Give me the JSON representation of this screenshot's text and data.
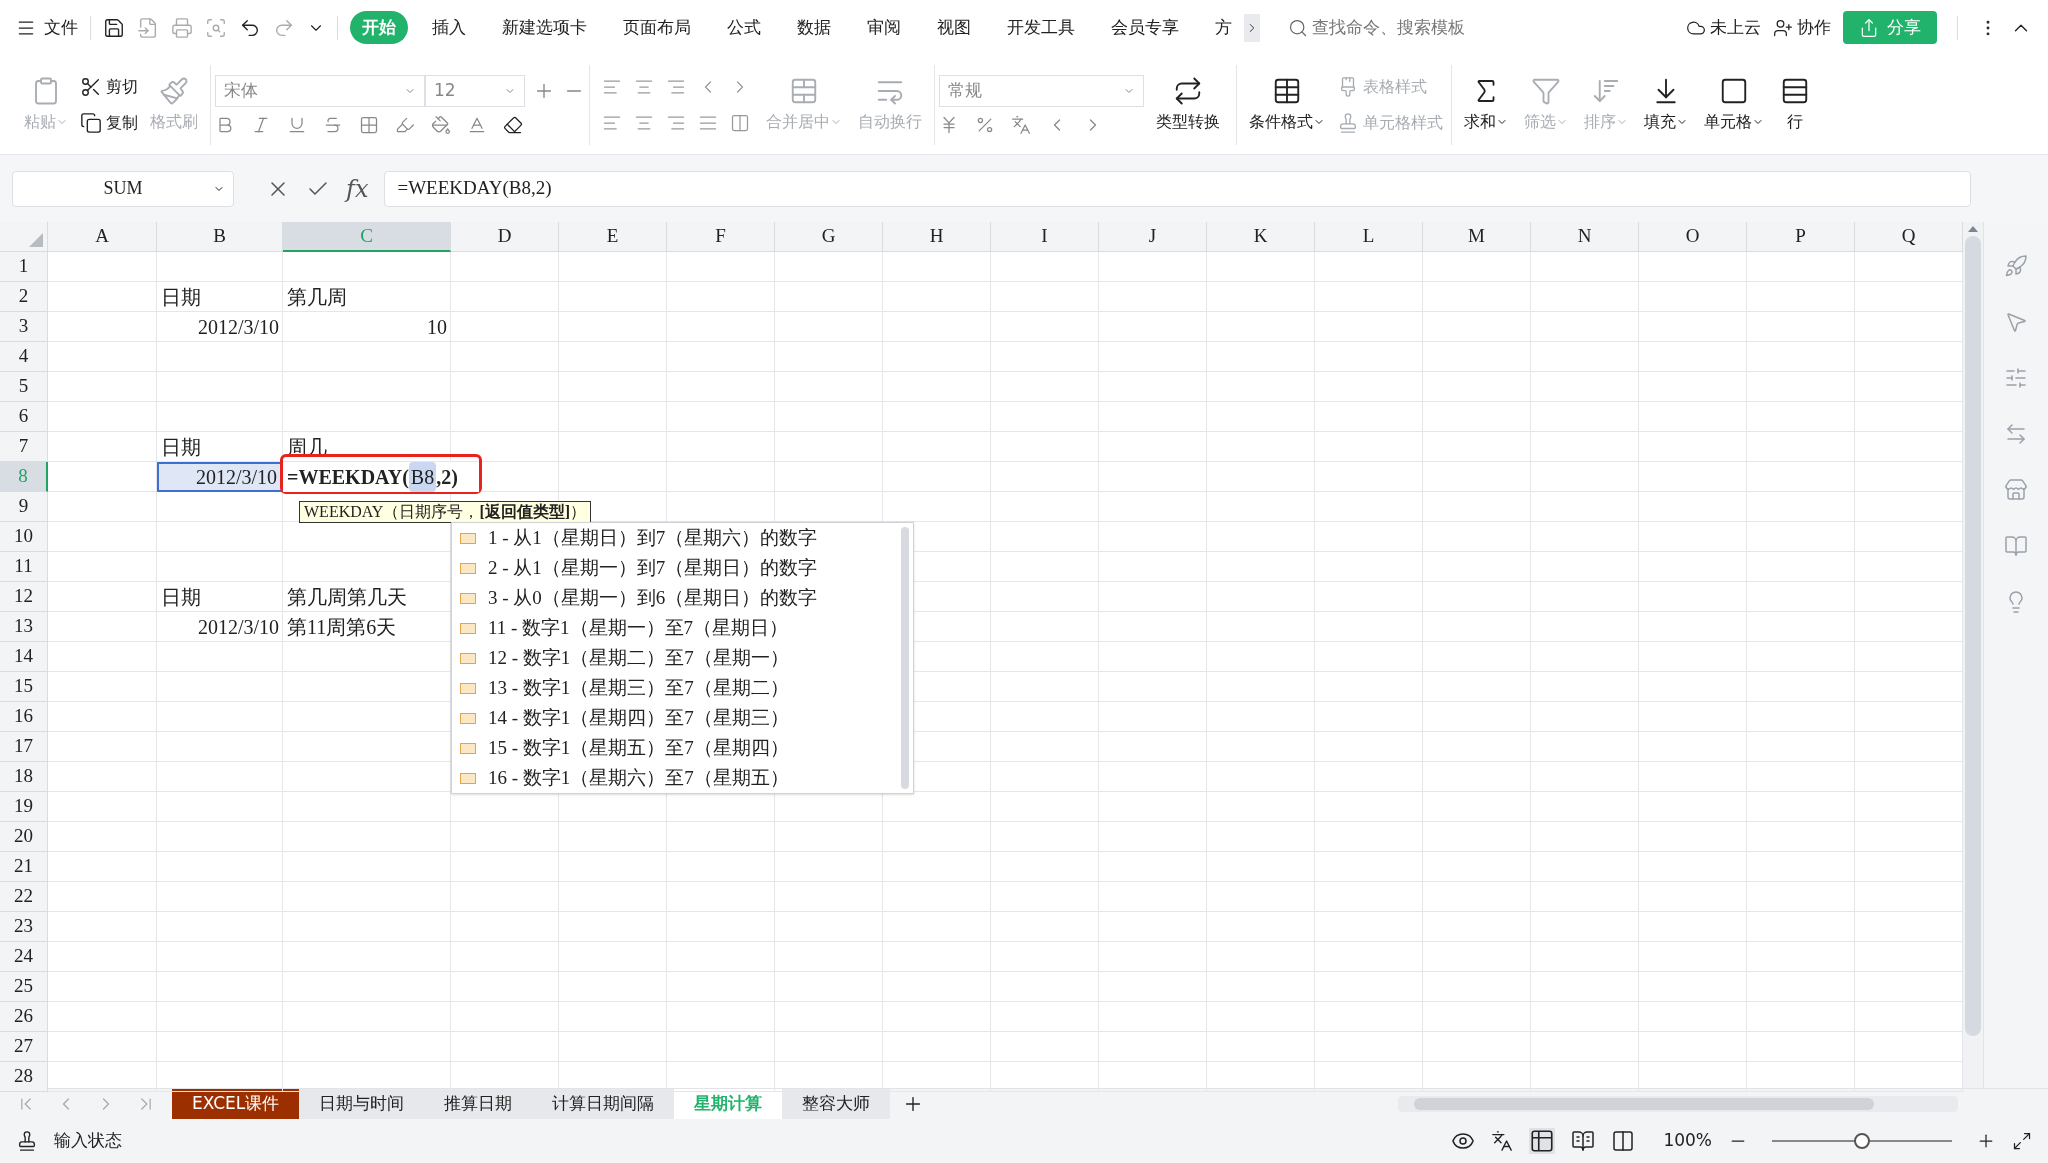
{
  "menu": {
    "file": "文件",
    "tabs": [
      {
        "label": "开始",
        "selected": true
      },
      {
        "label": "插入",
        "selected": false
      },
      {
        "label": "新建选项卡",
        "selected": false
      },
      {
        "label": "页面布局",
        "selected": false
      },
      {
        "label": "公式",
        "selected": false
      },
      {
        "label": "数据",
        "selected": false
      },
      {
        "label": "审阅",
        "selected": false
      },
      {
        "label": "视图",
        "selected": false
      },
      {
        "label": "开发工具",
        "selected": false
      },
      {
        "label": "会员专享",
        "selected": false
      },
      {
        "label": "方",
        "selected": false
      }
    ],
    "search_placeholder": "查找命令、搜索模板",
    "cloud": "未上云",
    "collaborate": "协作",
    "share": "分享"
  },
  "ribbon": {
    "clipboard": [
      {
        "label": "粘贴",
        "disabled": true
      },
      {
        "label": "剪切",
        "disabled": false
      },
      {
        "label": "复制",
        "disabled": false
      },
      {
        "label": "格式刷",
        "disabled": true
      }
    ],
    "font": {
      "name": "宋体",
      "size": "12"
    },
    "alignment": [
      {
        "label": "合并居中",
        "disabled": true
      },
      {
        "label": "自动换行",
        "disabled": true
      }
    ],
    "number": {
      "format": "常规",
      "convert": "类型转换"
    },
    "styles": [
      {
        "label": "条件格式",
        "disabled": false
      },
      {
        "label": "表格样式",
        "disabled": true
      },
      {
        "label": "单元格样式",
        "disabled": true
      }
    ],
    "editing": [
      {
        "label": "求和",
        "disabled": false
      },
      {
        "label": "筛选",
        "disabled": true
      },
      {
        "label": "排序",
        "disabled": true
      },
      {
        "label": "填充",
        "disabled": false
      },
      {
        "label": "单元格",
        "disabled": false
      },
      {
        "label": "行",
        "disabled": false
      }
    ]
  },
  "formula_bar": {
    "name_box": "SUM",
    "fx": "fx",
    "formula": "=WEEKDAY(B8,2)"
  },
  "columns": [
    {
      "label": "A",
      "selected": false
    },
    {
      "label": "B",
      "selected": false
    },
    {
      "label": "C",
      "selected": true
    },
    {
      "label": "D",
      "selected": false
    },
    {
      "label": "E",
      "selected": false
    },
    {
      "label": "F",
      "selected": false
    },
    {
      "label": "G",
      "selected": false
    },
    {
      "label": "H",
      "selected": false
    },
    {
      "label": "I",
      "selected": false
    },
    {
      "label": "J",
      "selected": false
    },
    {
      "label": "K",
      "selected": false
    },
    {
      "label": "L",
      "selected": false
    },
    {
      "label": "M",
      "selected": false
    },
    {
      "label": "N",
      "selected": false
    },
    {
      "label": "O",
      "selected": false
    },
    {
      "label": "P",
      "selected": false
    },
    {
      "label": "Q",
      "selected": false
    }
  ],
  "rows": [
    {
      "header": "1",
      "selected": false
    },
    {
      "header": "2",
      "selected": false,
      "cells": [
        null,
        {
          "kind": "text",
          "text": "日期"
        },
        {
          "kind": "text",
          "text": "第几周"
        }
      ]
    },
    {
      "header": "3",
      "selected": false,
      "cells": [
        null,
        {
          "kind": "number",
          "text": "2012/3/10"
        },
        {
          "kind": "number",
          "text": "10"
        }
      ]
    },
    {
      "header": "4",
      "selected": false
    },
    {
      "header": "5",
      "selected": false
    },
    {
      "header": "6",
      "selected": false
    },
    {
      "header": "7",
      "selected": false,
      "cells": [
        null,
        {
          "kind": "text",
          "text": "日期"
        },
        {
          "kind": "text",
          "text": "周几"
        }
      ]
    },
    {
      "header": "8",
      "selected": true,
      "cells": [
        null,
        {
          "kind": "number",
          "text": "2012/3/10",
          "selected": true
        },
        {
          "kind": "formula",
          "parts": [
            "=WEEKDAY(",
            "B8",
            ",2)"
          ]
        }
      ]
    },
    {
      "header": "9",
      "selected": false
    },
    {
      "header": "10",
      "selected": false
    },
    {
      "header": "11",
      "selected": false
    },
    {
      "header": "12",
      "selected": false,
      "cells": [
        null,
        {
          "kind": "text",
          "text": "日期"
        },
        {
          "kind": "text",
          "text": "第几周第几天"
        }
      ]
    },
    {
      "header": "13",
      "selected": false,
      "cells": [
        null,
        {
          "kind": "number",
          "text": "2012/3/10"
        },
        {
          "kind": "text",
          "text": "第11周第6天"
        }
      ]
    },
    {
      "header": "14",
      "selected": false
    },
    {
      "header": "15",
      "selected": false
    },
    {
      "header": "16",
      "selected": false
    },
    {
      "header": "17",
      "selected": false
    },
    {
      "header": "18",
      "selected": false
    },
    {
      "header": "19",
      "selected": false
    },
    {
      "header": "20",
      "selected": false
    },
    {
      "header": "21",
      "selected": false
    },
    {
      "header": "22",
      "selected": false
    },
    {
      "header": "23",
      "selected": false
    },
    {
      "header": "24",
      "selected": false
    },
    {
      "header": "25",
      "selected": false
    },
    {
      "header": "26",
      "selected": false
    },
    {
      "header": "27",
      "selected": false
    },
    {
      "header": "28",
      "selected": false
    }
  ],
  "tooltip": "WEEKDAY（日期序号，**[返回值类型]**）",
  "suggestions": [
    "1 - 从1（星期日）到7（星期六）的数字",
    "2 - 从1（星期一）到7（星期日）的数字",
    "3 - 从0（星期一）到6（星期日）的数字",
    "11 - 数字1（星期一）至7（星期日）",
    "12 - 数字1（星期二）至7（星期一）",
    "13 - 数字1（星期三）至7（星期二）",
    "14 - 数字1（星期四）至7（星期三）",
    "15 - 数字1（星期五）至7（星期四）",
    "16 - 数字1（星期六）至7（星期五）"
  ],
  "sheets": [
    {
      "label": "EXCEL课件",
      "selected": false,
      "color": "#9c2f00"
    },
    {
      "label": "日期与时间",
      "selected": false
    },
    {
      "label": "推算日期",
      "selected": false
    },
    {
      "label": "计算日期间隔",
      "selected": false
    },
    {
      "label": "星期计算",
      "selected": true
    },
    {
      "label": "整容大师",
      "selected": false
    }
  ],
  "status": {
    "mode": "输入状态",
    "zoom": "100%",
    "zoom_level": {
      "level": 0.5
    }
  }
}
